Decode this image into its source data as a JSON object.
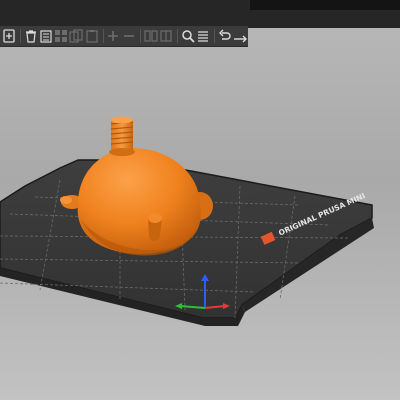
{
  "window": {
    "title": ""
  },
  "toolbar": {
    "items": [
      {
        "name": "add-icon",
        "enabled": true
      },
      {
        "name": "delete-icon",
        "enabled": true
      },
      {
        "name": "delete-all-icon",
        "enabled": true
      },
      {
        "name": "arrange-icon",
        "enabled": false
      },
      {
        "name": "copy-icon",
        "enabled": false
      },
      {
        "name": "paste-icon",
        "enabled": false
      },
      {
        "name": "add-instance-icon",
        "enabled": false
      },
      {
        "name": "remove-instance-icon",
        "enabled": false
      },
      {
        "name": "split-objects-icon",
        "enabled": false
      },
      {
        "name": "split-parts-icon",
        "enabled": false
      },
      {
        "name": "search-icon",
        "enabled": true
      },
      {
        "name": "layers-editing-icon",
        "enabled": true
      },
      {
        "name": "undo-icon",
        "enabled": true
      },
      {
        "name": "redo-icon",
        "enabled": true
      }
    ]
  },
  "bed": {
    "label": "ORIGINAL PRUSA MINI",
    "logo_text": "prusa"
  },
  "colors": {
    "model": "#f0821e",
    "bed": "#3a3a3a",
    "grid": "#6a6a6a",
    "axis_x": "#e23b3b",
    "axis_y": "#2fbf3a",
    "axis_z": "#2b5cff",
    "background": "#b3b3b3"
  }
}
